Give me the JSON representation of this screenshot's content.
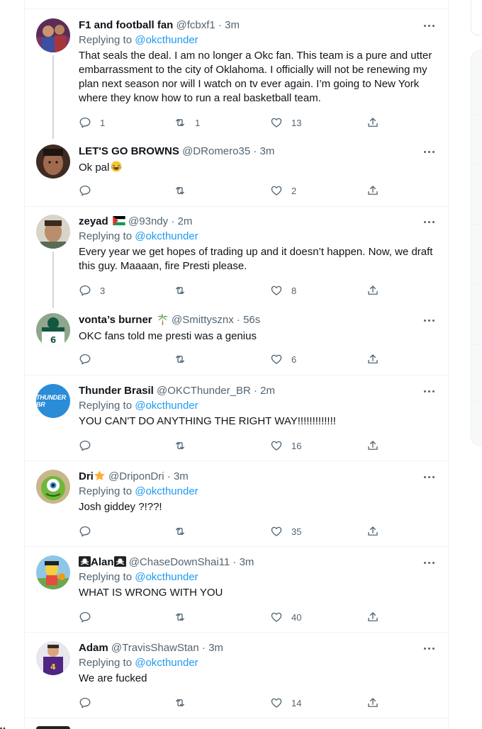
{
  "replying_label": "Replying to",
  "tweets": [
    {
      "name": "F1 and football fan",
      "handle": "@fcbxf1",
      "time": "3m",
      "reply_to": "@okcthunder",
      "text": "That seals the deal. I am no longer a Okc fan. This team is a pure and utter embarrassment to the city of Oklahoma. I officially will not be renewing my plan next season nor will I watch on tv ever again. I’m going to New York where they know how to run a real basketball team.",
      "replies": "1",
      "retweets": "1",
      "likes": "13"
    },
    {
      "name": "LET'S GO BROWNS",
      "handle": "@DRomero35",
      "time": "3m",
      "reply_to": "",
      "text": "Ok pal",
      "replies": "",
      "retweets": "",
      "likes": "2"
    },
    {
      "name": "zeyad",
      "handle": "@93ndy",
      "time": "2m",
      "reply_to": "@okcthunder",
      "text": "Every year we get hopes of trading up and it doesn’t happen. Now, we draft this guy. Maaaan, fire Presti please.",
      "replies": "3",
      "retweets": "",
      "likes": "8"
    },
    {
      "name": "vonta’s burner",
      "handle": "@Smittysznx",
      "time": "56s",
      "reply_to": "",
      "text": "OKC fans told me presti was a genius",
      "replies": "",
      "retweets": "",
      "likes": "6"
    },
    {
      "name": "Thunder Brasil",
      "handle": "@OKCThunder_BR",
      "time": "2m",
      "reply_to": "@okcthunder",
      "text": "YOU CAN'T DO ANYTHING THE RIGHT WAY!!!!!!!!!!!!!",
      "replies": "",
      "retweets": "",
      "likes": "16",
      "avatar_text": "THUNDER BR"
    },
    {
      "name": "Dri",
      "handle": "@DriponDri",
      "time": "3m",
      "reply_to": "@okcthunder",
      "text": "Josh giddey ?!??!",
      "replies": "",
      "retweets": "",
      "likes": "35"
    },
    {
      "name": "Alan",
      "handle": "@ChaseDownShai11",
      "time": "3m",
      "reply_to": "@okcthunder",
      "text": "WHAT IS WRONG WITH YOU",
      "replies": "",
      "retweets": "",
      "likes": "40"
    },
    {
      "name": "Adam",
      "handle": "@TravisShawStan",
      "time": "3m",
      "reply_to": "@okcthunder",
      "text": "We are fucked",
      "replies": "",
      "retweets": "",
      "likes": "14"
    }
  ],
  "colors": {
    "text": "#0f1419",
    "muted": "#536471",
    "link": "#1d9bf0",
    "border": "#eff3f4",
    "thread_line": "#cfd9de",
    "thunder_brasil_avatar": "#2b8cd8"
  },
  "icons": [
    "reply-icon",
    "retweet-icon",
    "like-icon",
    "share-icon",
    "more-icon"
  ]
}
